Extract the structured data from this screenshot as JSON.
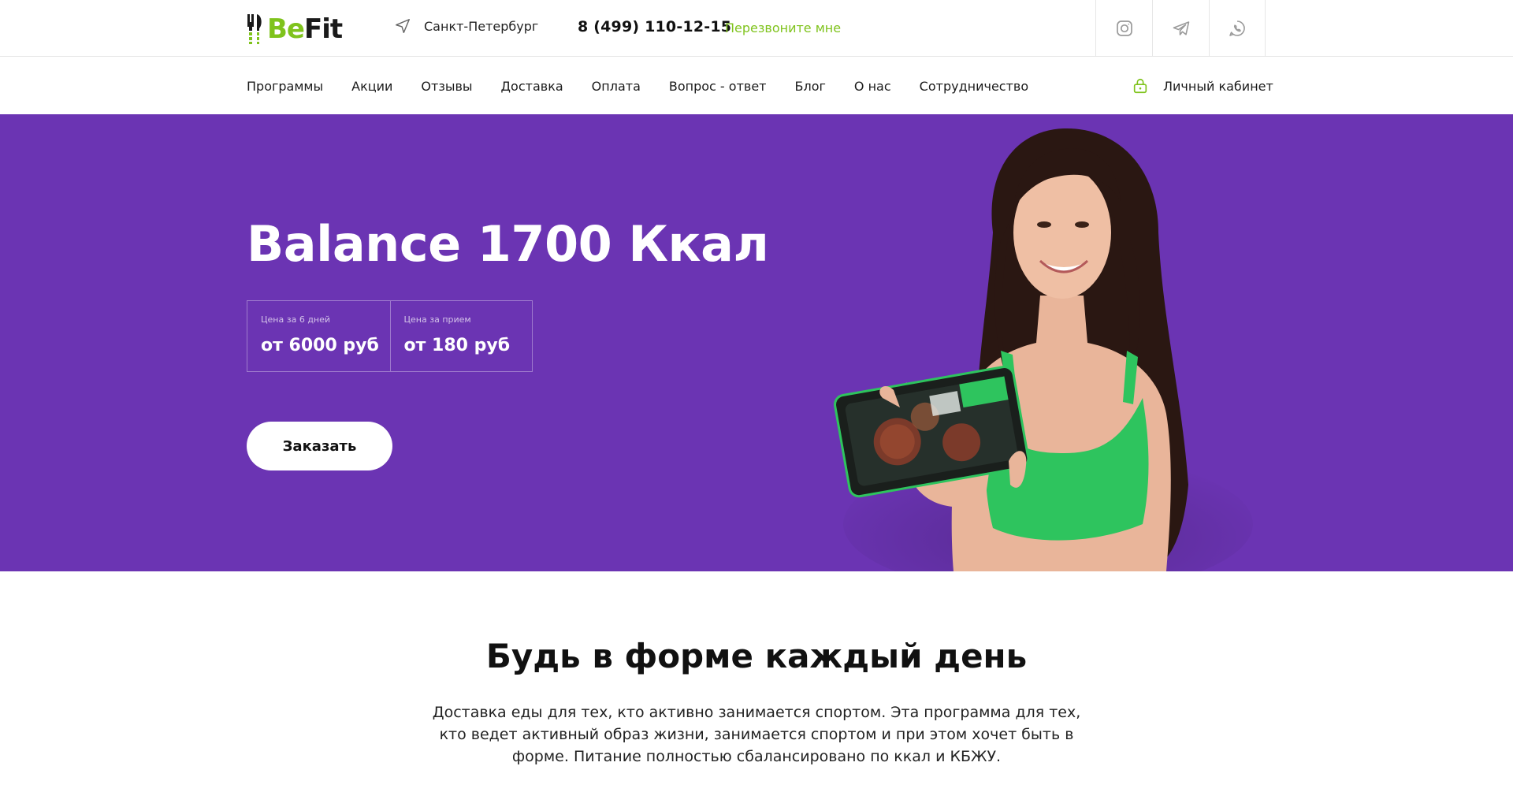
{
  "brand": {
    "logo_be": "Be",
    "logo_fit": "Fit",
    "accent_color": "#7fc31c",
    "hero_color": "#6b34b3"
  },
  "header": {
    "city": "Санкт-Петербург",
    "phone": "8 (499) 110-12-15",
    "callback_label": "Перезвоните мне",
    "socials": [
      {
        "icon": "instagram-icon"
      },
      {
        "icon": "telegram-icon"
      },
      {
        "icon": "whatsapp-icon"
      }
    ]
  },
  "nav": {
    "items": [
      {
        "label": "Программы"
      },
      {
        "label": "Акции"
      },
      {
        "label": "Отзывы"
      },
      {
        "label": "Доставка"
      },
      {
        "label": "Оплата"
      },
      {
        "label": "Вопрос - ответ"
      },
      {
        "label": "Блог"
      },
      {
        "label": "О нас"
      },
      {
        "label": "Сотрудничество"
      }
    ],
    "cabinet_label": "Личный кабинет"
  },
  "hero": {
    "title": "Balance 1700 Ккал",
    "prices": [
      {
        "label": "Цена за 6 дней",
        "value": "от 6000 руб"
      },
      {
        "label": "Цена за прием",
        "value": "от 180 руб"
      }
    ],
    "order_label": "Заказать"
  },
  "intro": {
    "title": "Будь в форме каждый день",
    "text": "Доставка еды для тех, кто активно занимается спортом. Эта программа для тех, кто ведет активный образ жизни, занимается спортом и при этом хочет быть в форме. Питание полностью сбалансировано по ккал и КБЖУ."
  }
}
